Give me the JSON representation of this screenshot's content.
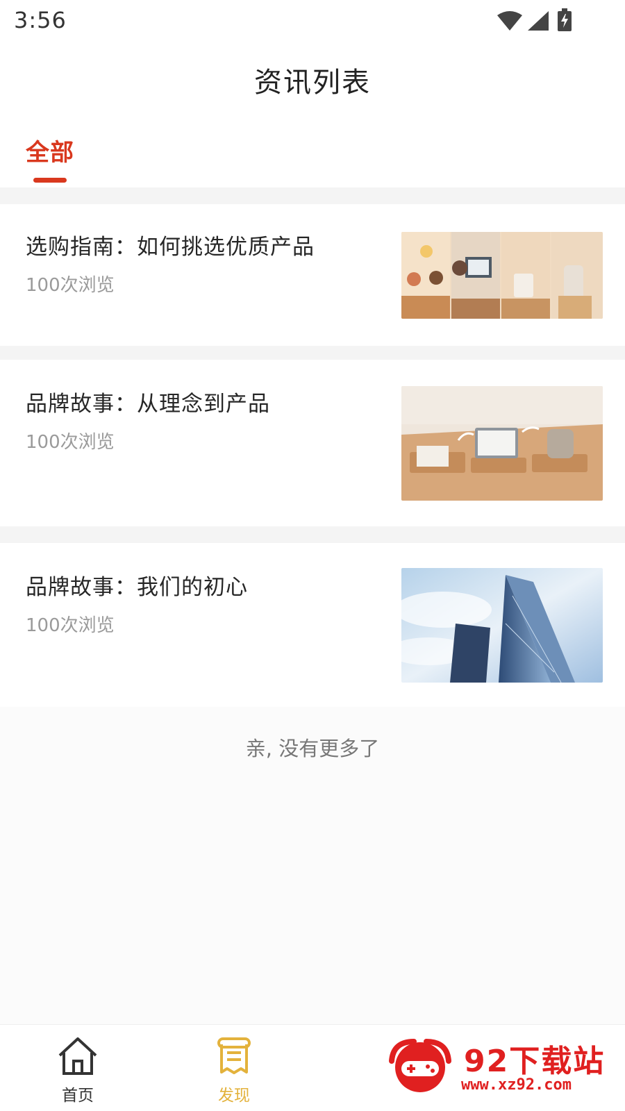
{
  "status_bar": {
    "time": "3:56"
  },
  "header": {
    "title": "资讯列表"
  },
  "tabs": {
    "items": [
      {
        "label": "全部",
        "active": true
      }
    ]
  },
  "colors": {
    "accent": "#d9381e",
    "tab_active_bottom": "#e3b23c",
    "tab_inactive": "#333333"
  },
  "articles": [
    {
      "title": "选购指南：如何挑选优质产品",
      "views": "100次浏览",
      "image_icon": "product-design-collage"
    },
    {
      "title": "品牌故事：从理念到产品",
      "views": "100次浏览",
      "image_icon": "notebook-laptop-product"
    },
    {
      "title": "品牌故事：我们的初心",
      "views": "100次浏览",
      "image_icon": "glass-skyscraper"
    }
  ],
  "list_footer": "亲, 没有更多了",
  "bottom_nav": {
    "items": [
      {
        "label": "首页",
        "icon": "home-icon",
        "active": false
      },
      {
        "label": "发现",
        "icon": "discover-icon",
        "active": true
      }
    ]
  },
  "watermark": {
    "name": "92下载站",
    "url": "www.xz92.com"
  }
}
